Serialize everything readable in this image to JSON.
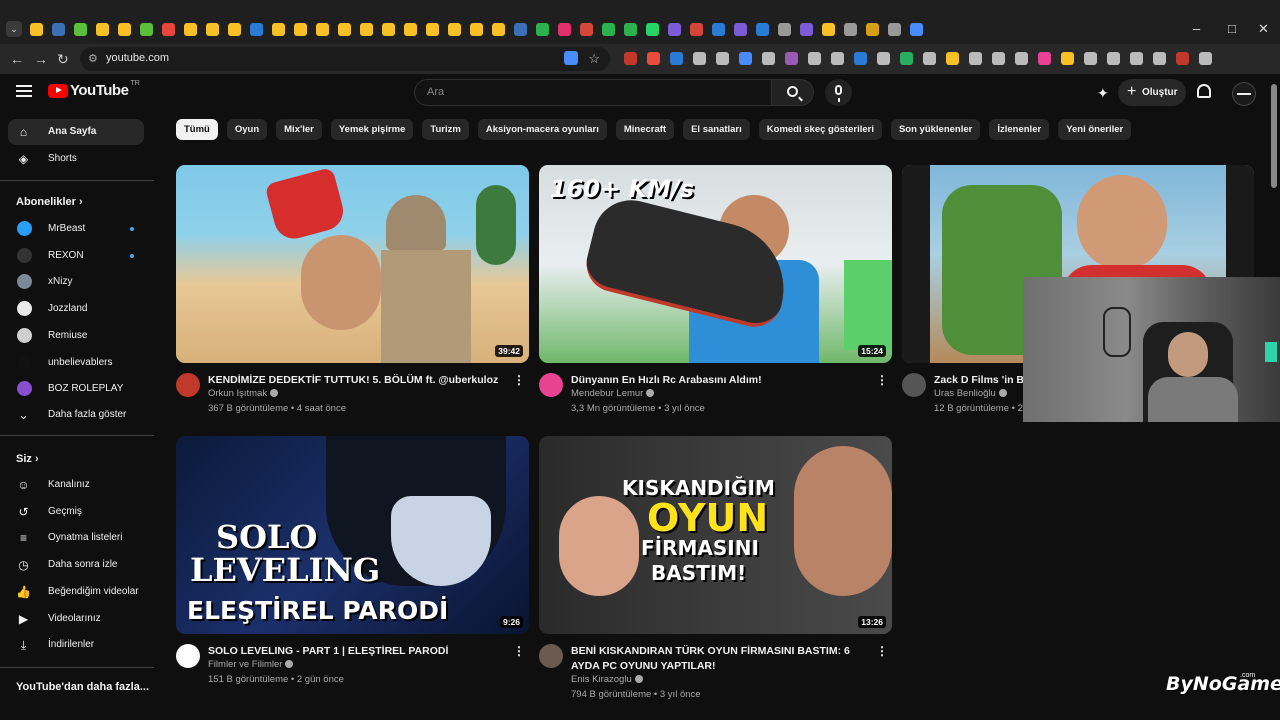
{
  "browser": {
    "url": "youtube.com",
    "window_controls": [
      "–",
      "□",
      "✕"
    ]
  },
  "header": {
    "logo_text": "YouTube",
    "logo_region": "TR",
    "search_placeholder": "Ara",
    "create_label": "Oluştur"
  },
  "sidebar": {
    "main": [
      {
        "label": "Ana Sayfa",
        "icon": "home-icon",
        "glyph": "⌂"
      },
      {
        "label": "Shorts",
        "icon": "shorts-icon",
        "glyph": "◈"
      }
    ],
    "subscriptions_title": "Abonelikler",
    "subscriptions": [
      {
        "label": "MrBeast",
        "color": "#2a9df4",
        "dot": true
      },
      {
        "label": "REXON",
        "color": "#333333",
        "dot": true
      },
      {
        "label": "xNizy",
        "color": "#7a8a99",
        "dot": false
      },
      {
        "label": "Jozzland",
        "color": "#e9e9e9",
        "dot": false
      },
      {
        "label": "Remiuse",
        "color": "#cfcfcf",
        "dot": false
      },
      {
        "label": "unbelievablers",
        "color": "#111111",
        "dot": false
      },
      {
        "label": "BOZ ROLEPLAY",
        "color": "#8a4fd0",
        "dot": false
      }
    ],
    "show_more": "Daha fazla göster",
    "you_title": "Siz",
    "you": [
      {
        "label": "Kanalınız",
        "icon": "channel-icon",
        "glyph": "☺"
      },
      {
        "label": "Geçmiş",
        "icon": "history-icon",
        "glyph": "↺"
      },
      {
        "label": "Oynatma listeleri",
        "icon": "playlist-icon",
        "glyph": "≡"
      },
      {
        "label": "Daha sonra izle",
        "icon": "clock-icon",
        "glyph": "◷"
      },
      {
        "label": "Beğendiğim videolar",
        "icon": "like-icon",
        "glyph": "👍"
      },
      {
        "label": "Videolarınız",
        "icon": "your-videos-icon",
        "glyph": "▶"
      },
      {
        "label": "İndirilenler",
        "icon": "download-icon",
        "glyph": "⤓"
      }
    ],
    "more_from_youtube": "YouTube'dan daha fazla..."
  },
  "chips": [
    "Tümü",
    "Oyun",
    "Mix'ler",
    "Yemek pişirme",
    "Turizm",
    "Aksiyon-macera oyunları",
    "Minecraft",
    "El sanatları",
    "Komedi skeç gösterileri",
    "Son yüklenenler",
    "İzlenenler",
    "Yeni öneriler"
  ],
  "videos": [
    {
      "title": "KENDİMİZE DEDEKTİF TUTTUK! 5. BÖLÜM ft. @uberkuloz",
      "channel": "Orkun Işıtmak",
      "meta": "367 B görüntüleme • 4 saat önce",
      "duration": "39:42",
      "avatar_color": "#c0392b"
    },
    {
      "title": "Dünyanın En Hızlı Rc Arabasını Aldım!",
      "channel": "Mendebur Lemur",
      "meta": "3,3 Mn görüntüleme • 3 yıl önce",
      "duration": "15:24",
      "thumb_text": "160+ KM/s",
      "avatar_color": "#e84393"
    },
    {
      "title": "Zack D Films 'in Bü",
      "channel": "Uras Benlioğlu",
      "meta": "12 B görüntüleme • 2",
      "avatar_color": "#555555"
    },
    {
      "title": "SOLO LEVELING - PART 1 | ELEŞTİREL PARODİ",
      "channel": "Filmler ve Filimler",
      "meta": "151 B görüntüleme • 2 gün önce",
      "duration": "9:26",
      "thumb_text_1": "SOLO",
      "thumb_text_2": "LEVELING",
      "thumb_text_3": "ELEŞTİREL PARODİ",
      "avatar_color": "#ffffff"
    },
    {
      "title": "BENİ KISKANDIRAN TÜRK OYUN FİRMASINI BASTIM: 6 AYDA PC OYUNU YAPTILAR!",
      "channel": "Enis Kirazoglu",
      "meta": "794 B görüntüleme • 3 yıl önce",
      "duration": "13:26",
      "thumb_text_1": "KISKANDIĞIM",
      "thumb_text_2": "OYUN",
      "thumb_text_3": "FİRMASINI",
      "thumb_text_4": "BASTIM!",
      "avatar_color": "#6b5a4e"
    }
  ],
  "watermark": "ByNoGame",
  "watermark_suffix": ".com"
}
